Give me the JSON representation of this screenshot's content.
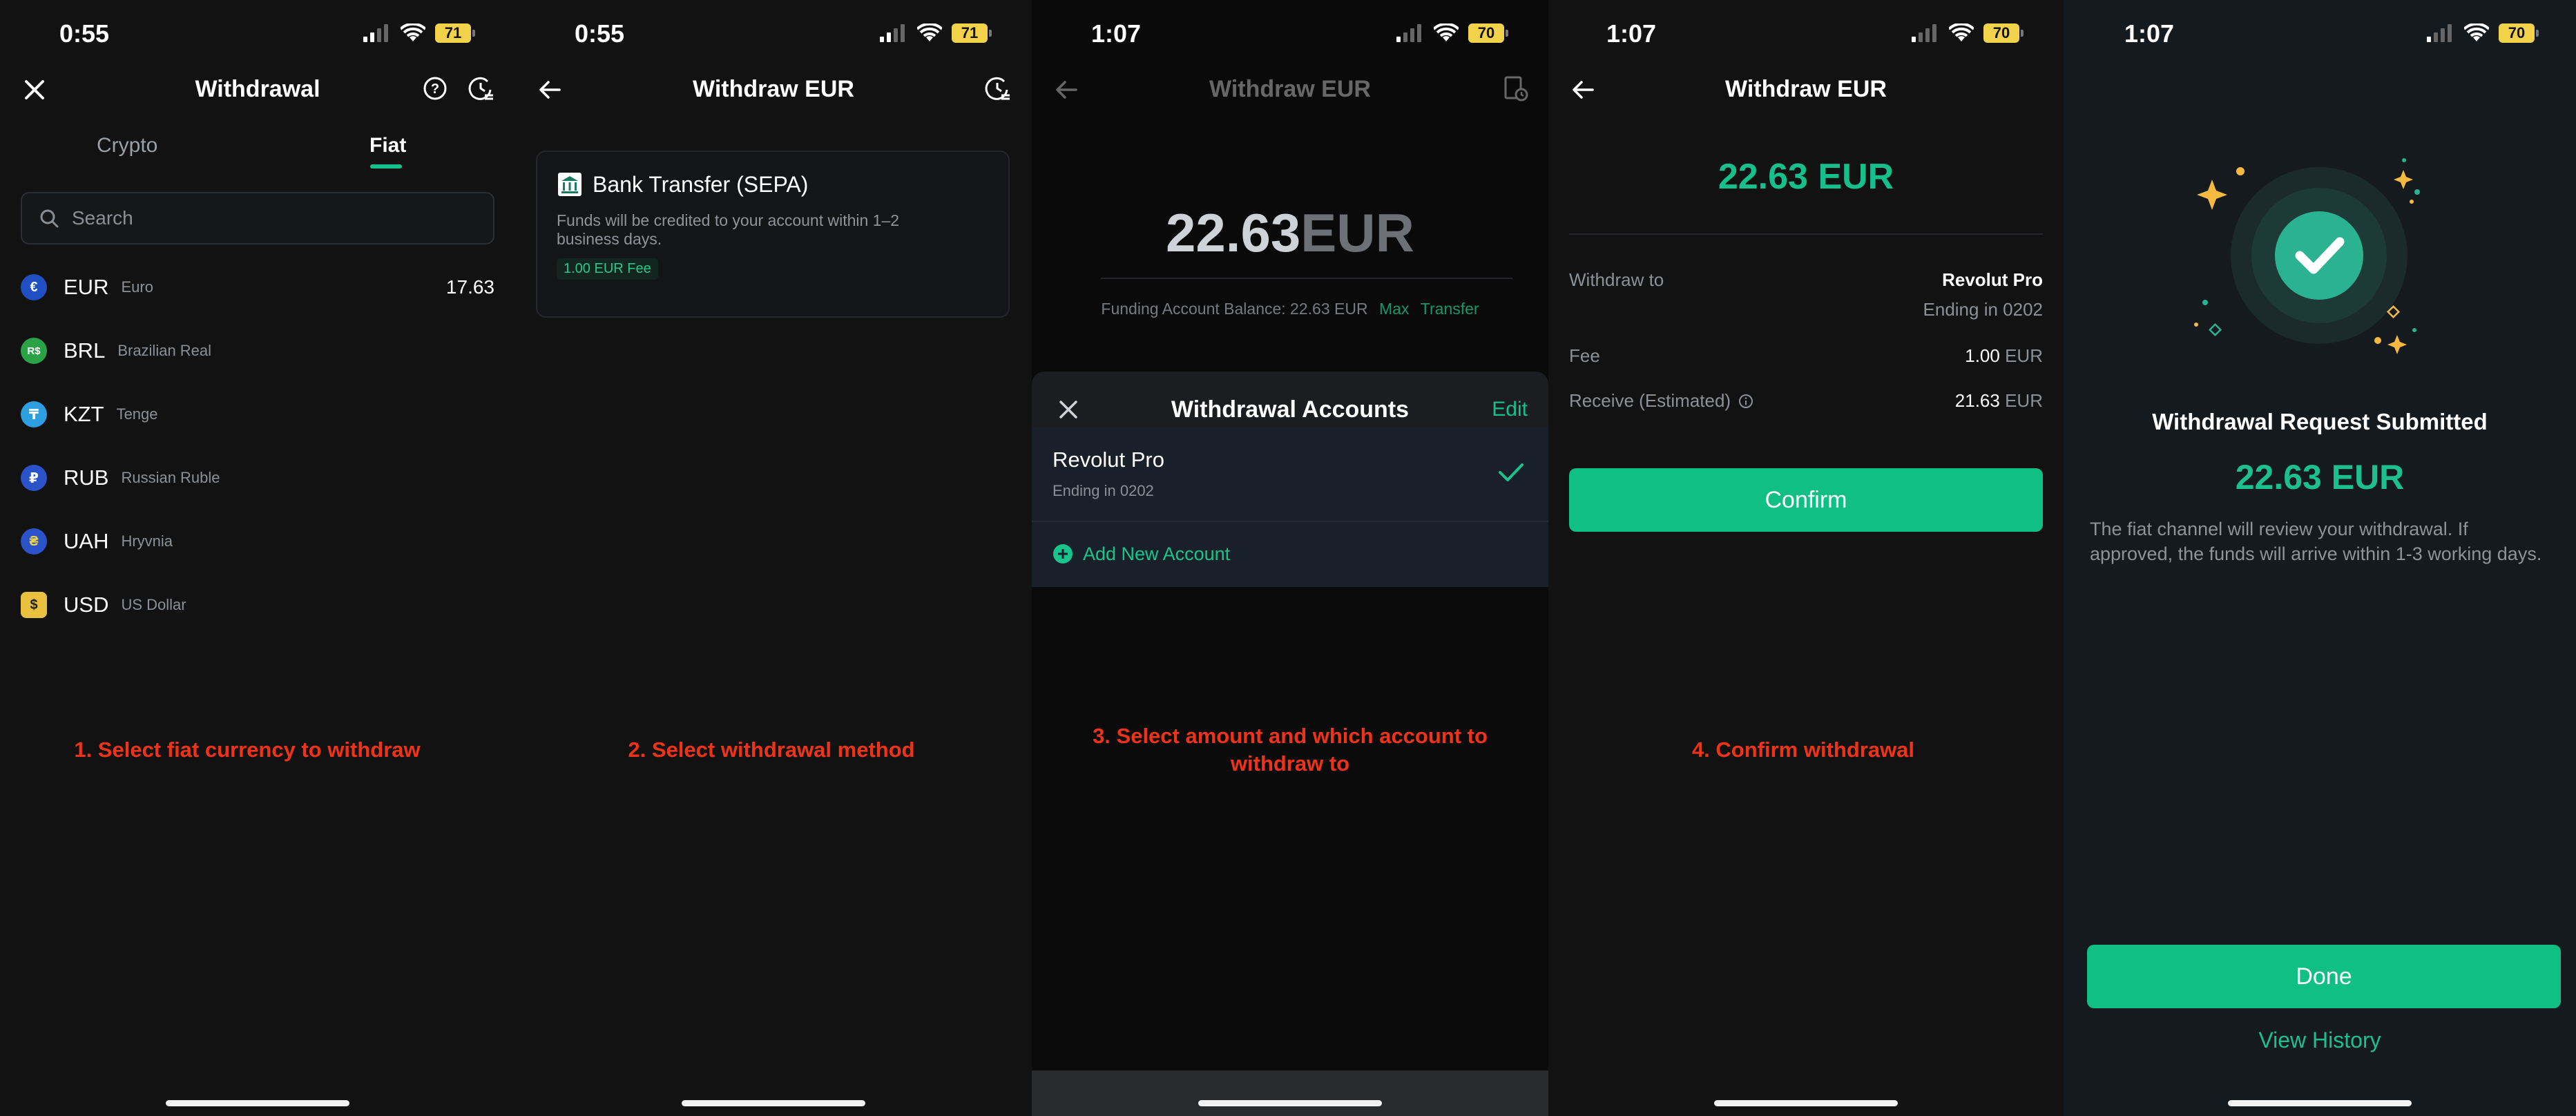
{
  "colors": {
    "accent": "#0fbf84",
    "caption": "#ef3318",
    "battery": "#f2d24a"
  },
  "screens": [
    {
      "status": {
        "time": "0:55",
        "battery": "71"
      },
      "nav": {
        "title": "Withdrawal"
      },
      "tabs": [
        {
          "label": "Crypto"
        },
        {
          "label": "Fiat"
        }
      ],
      "search": {
        "placeholder": "Search"
      },
      "currencies": [
        {
          "code": "EUR",
          "name": "Euro",
          "balance": "17.63",
          "symbol": "€",
          "color": "#1f4fc2"
        },
        {
          "code": "BRL",
          "name": "Brazilian Real",
          "balance": "",
          "symbol": "R$",
          "color": "#2aa346"
        },
        {
          "code": "KZT",
          "name": "Tenge",
          "balance": "",
          "symbol": "₸",
          "color": "#2d9fe0"
        },
        {
          "code": "RUB",
          "name": "Russian Ruble",
          "balance": "",
          "symbol": "₽",
          "color": "#2a53c9"
        },
        {
          "code": "UAH",
          "name": "Hryvnia",
          "balance": "",
          "symbol": "₴",
          "color": "#2a53c9"
        },
        {
          "code": "USD",
          "name": "US Dollar",
          "balance": "",
          "symbol": "$",
          "color": "#e9c13f"
        }
      ],
      "caption": "1. Select fiat currency to withdraw"
    },
    {
      "status": {
        "time": "0:55",
        "battery": "71"
      },
      "nav": {
        "title": "Withdraw EUR"
      },
      "method": {
        "title": "Bank Transfer (SEPA)",
        "description": "Funds will be credited to your account within 1–2 business days.",
        "fee": "1.00 EUR Fee"
      },
      "caption": "2. Select withdrawal method"
    },
    {
      "status": {
        "time": "1:07",
        "battery": "70"
      },
      "nav": {
        "title": "Withdraw EUR"
      },
      "amount": {
        "value": "22.63",
        "unit": "EUR"
      },
      "balance": {
        "text": "Funding Account Balance: 22.63 EUR",
        "max": "Max",
        "transfer": "Transfer"
      },
      "sheet": {
        "title": "Withdrawal Accounts",
        "edit": "Edit",
        "account": {
          "name": "Revolut Pro",
          "ending": "Ending in 0202"
        },
        "add": "Add New Account"
      },
      "caption_line1": "3. Select amount and which account to",
      "caption_line2": "withdraw to"
    },
    {
      "status": {
        "time": "1:07",
        "battery": "70"
      },
      "nav": {
        "title": "Withdraw EUR"
      },
      "amount": "22.63 EUR",
      "withdraw_to": {
        "label": "Withdraw to",
        "name": "Revolut Pro",
        "ending": "Ending in 0202"
      },
      "fee": {
        "label": "Fee",
        "value": "1.00",
        "unit": "EUR"
      },
      "receive": {
        "label": "Receive (Estimated)",
        "value": "21.63",
        "unit": "EUR"
      },
      "confirm": "Confirm",
      "caption": "4. Confirm withdrawal"
    },
    {
      "status": {
        "time": "1:07",
        "battery": "70"
      },
      "title": "Withdrawal Request Submitted",
      "amount": "22.63 EUR",
      "description": "The fiat channel will review your withdrawal. If approved, the funds will arrive within 1-3 working days.",
      "done": "Done",
      "view_history": "View History"
    }
  ]
}
